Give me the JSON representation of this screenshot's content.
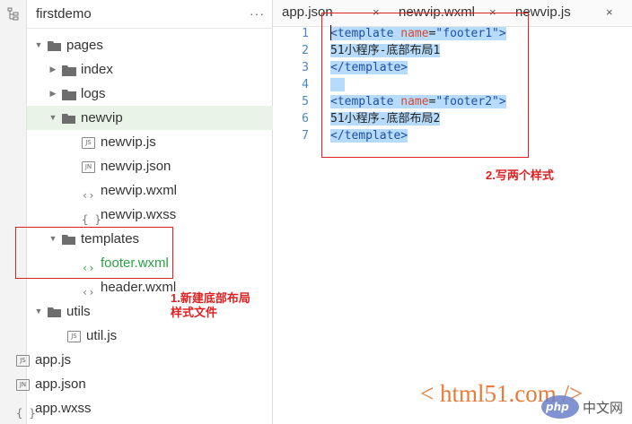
{
  "sidebar": {
    "project_title": "firstdemo",
    "more_label": "···",
    "tree": [
      {
        "label": "pages",
        "kind": "folder",
        "expanded": true
      },
      {
        "label": "index",
        "kind": "folder",
        "expanded": false
      },
      {
        "label": "logs",
        "kind": "folder",
        "expanded": false
      },
      {
        "label": "newvip",
        "kind": "folder",
        "expanded": true
      },
      {
        "label": "newvip.js",
        "kind": "js",
        "badge": "JS"
      },
      {
        "label": "newvip.json",
        "kind": "json",
        "badge": "JN"
      },
      {
        "label": "newvip.wxml",
        "kind": "wxml",
        "glyph": "<>"
      },
      {
        "label": "newvip.wxss",
        "kind": "wxss",
        "glyph": "{}"
      },
      {
        "label": "templates",
        "kind": "folder",
        "expanded": true
      },
      {
        "label": "footer.wxml",
        "kind": "wxml",
        "glyph": "<>"
      },
      {
        "label": "header.wxml",
        "kind": "wxml",
        "glyph": "<>"
      },
      {
        "label": "utils",
        "kind": "folder",
        "expanded": true
      },
      {
        "label": "util.js",
        "kind": "js",
        "badge": "JS"
      },
      {
        "label": "app.js",
        "kind": "js",
        "badge": "JS"
      },
      {
        "label": "app.json",
        "kind": "json",
        "badge": "JN"
      },
      {
        "label": "app.wxss",
        "kind": "wxss",
        "glyph": "{}"
      }
    ]
  },
  "editor": {
    "tabs": [
      {
        "label": "app.json",
        "close": "×"
      },
      {
        "label": "newvip.wxml",
        "close": "×"
      },
      {
        "label": "newvip.js",
        "close": "×"
      }
    ],
    "line_numbers": [
      "1",
      "2",
      "3",
      "4",
      "5",
      "6",
      "7"
    ],
    "code": {
      "l1_open": "<template ",
      "l1_attr": "name",
      "l1_eq": "=",
      "l1_val": "\"footer1\"",
      "l1_close": ">",
      "l2": "51小程序-底部布局1",
      "l3": "</template>",
      "l5_open": "<template ",
      "l5_attr": "name",
      "l5_eq": "=",
      "l5_val": "\"footer2\"",
      "l5_close": ">",
      "l6": "51小程序-底部布局2",
      "l7": "</template>"
    }
  },
  "annotations": {
    "step1_line1": "1.新建底部布局",
    "step1_line2": "样式文件",
    "step2": "2.写两个样式"
  },
  "watermark": {
    "site": "< html51.com />",
    "logo_php": "php",
    "logo_cn": "中文网"
  },
  "colors": {
    "active_file": "#2ba245",
    "selection": "#b7dcfb",
    "annotation": "#e02020"
  }
}
